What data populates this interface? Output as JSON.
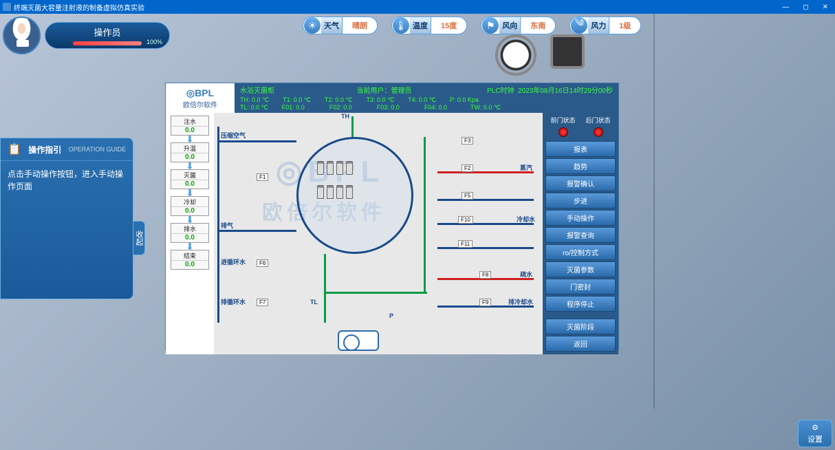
{
  "window": {
    "title": "终端灭菌大容量注射液的制备虚拟仿真实验",
    "minimize": "—",
    "maximize": "◻",
    "close": "✕"
  },
  "operator": {
    "name": "操作员",
    "hp_percent": "100%"
  },
  "env": {
    "weather": {
      "label": "天气",
      "value": "晴朗"
    },
    "temp": {
      "label": "温度",
      "value": "15度"
    },
    "wind_dir": {
      "label": "风向",
      "value": "东南"
    },
    "wind_force": {
      "label": "风力",
      "value": "1级"
    }
  },
  "guide": {
    "title": "操作指引",
    "subtitle": "OPERATION GUIDE",
    "content": "点击手动操作按钮，进入手动操作页面",
    "collapse": "收起"
  },
  "hmi": {
    "logo_top": "◎BPL",
    "logo_bottom": "欧倍尔软件",
    "system_name": "水浴灭菌柜",
    "user_label": "当前用户：",
    "user_value": "管理员",
    "clock_label": "PLC时钟",
    "clock_value": "2023年08月16日14时29分00秒",
    "params": {
      "th": "TH:",
      "th_v": "0.0",
      "th_u": "℃",
      "t1": "T1:",
      "t1_v": "0.0",
      "t1_u": "℃",
      "t2": "T2:",
      "t2_v": "0.0",
      "t2_u": "℃",
      "t3": "T3:",
      "t3_v": "0.0",
      "t3_u": "℃",
      "t4": "T4:",
      "t4_v": "0.0",
      "t4_u": "℃",
      "p": "P:",
      "p_v": "0.0",
      "p_u": "Kpa",
      "tl": "TL:",
      "tl_v": "0.0",
      "tl_u": "℃",
      "f01": "F01:",
      "f01_v": "0.0",
      "f02": "F02:",
      "f02_v": "0.0",
      "f03": "F03:",
      "f03_v": "0.0",
      "f04": "F04:",
      "f04_v": "0.0",
      "tw": "TW:",
      "tw_v": "0.0",
      "tw_u": "℃"
    },
    "steps": [
      {
        "label": "注水",
        "value": "0.0"
      },
      {
        "label": "升温",
        "value": "0.0"
      },
      {
        "label": "灭菌",
        "value": "0.0"
      },
      {
        "label": "冷却",
        "value": "0.0"
      },
      {
        "label": "排水",
        "value": "0.0"
      },
      {
        "label": "结束",
        "value": "0.0"
      }
    ],
    "pid_labels": {
      "th": "TH",
      "tl": "TL",
      "p": "P",
      "compressed_air": "压缩空气",
      "exhaust": "排气",
      "circ_in": "进循环水",
      "circ_out": "排循环水",
      "steam": "蒸汽",
      "cooling": "冷却水",
      "drain": "疏水",
      "cold_discharge": "排冷却水",
      "f1": "F1",
      "f2": "F2",
      "f3": "F3",
      "f5": "F5",
      "f6": "F6",
      "f7": "F7",
      "f8": "F8",
      "f9": "F9",
      "f10": "F10",
      "f11": "F11"
    },
    "door": {
      "front": "前门状态",
      "back": "后门状态"
    },
    "buttons": [
      "报表",
      "趋势",
      "报警确认",
      "步进",
      "手动操作",
      "报警查询",
      "ro/控制方式",
      "灭菌参数",
      "门密封",
      "程序停止"
    ],
    "phase_label": "灭菌阶段",
    "return_btn": "返回"
  },
  "settings": "设置"
}
